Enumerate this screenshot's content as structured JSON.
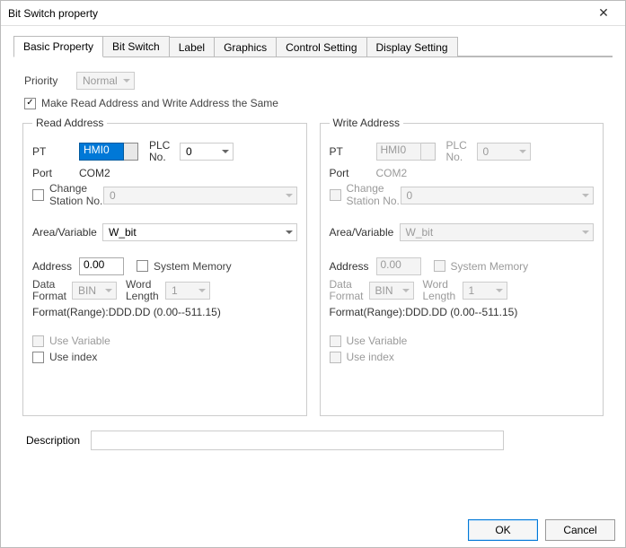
{
  "window": {
    "title": "Bit Switch property",
    "close": "✕"
  },
  "tabs": [
    "Basic Property",
    "Bit Switch",
    "Label",
    "Graphics",
    "Control Setting",
    "Display Setting"
  ],
  "priority": {
    "label": "Priority",
    "value": "Normal"
  },
  "same_addr": {
    "checked": "✓",
    "label": "Make Read Address and Write Address the Same"
  },
  "read": {
    "legend": "Read Address",
    "pt_label": "PT",
    "pt_value": "HMI0",
    "plc_label": "PLC No.",
    "plc_value": "0",
    "port_label": "Port",
    "port_value": "COM2",
    "change_station_label": "Change Station No.",
    "station_value": "0",
    "area_label": "Area/Variable",
    "area_value": "W_bit",
    "address_label": "Address",
    "address_value": "0.00",
    "system_memory_label": "System Memory",
    "format_label": "Data Format",
    "format_value": "BIN",
    "wordlen_label": "Word Length",
    "wordlen_value": "1",
    "range_text": "Format(Range):DDD.DD (0.00--511.15)",
    "use_variable": "Use Variable",
    "use_index": "Use index"
  },
  "write": {
    "legend": "Write Address",
    "pt_label": "PT",
    "pt_value": "HMI0",
    "plc_label": "PLC No.",
    "plc_value": "0",
    "port_label": "Port",
    "port_value": "COM2",
    "change_station_label": "Change Station No.",
    "station_value": "0",
    "area_label": "Area/Variable",
    "area_value": "W_bit",
    "address_label": "Address",
    "address_value": "0.00",
    "system_memory_label": "System Memory",
    "format_label": "Data Format",
    "format_value": "BIN",
    "wordlen_label": "Word Length",
    "wordlen_value": "1",
    "range_text": "Format(Range):DDD.DD (0.00--511.15)",
    "use_variable": "Use Variable",
    "use_index": "Use index"
  },
  "description": {
    "label": "Description",
    "value": ""
  },
  "buttons": {
    "ok": "OK",
    "cancel": "Cancel"
  }
}
